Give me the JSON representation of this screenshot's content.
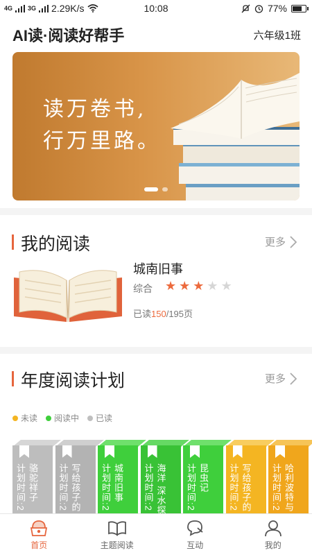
{
  "status_bar": {
    "signal_1": "4G",
    "signal_2": "3G",
    "network_speed": "2.29K/s",
    "time": "10:08",
    "battery": "77%",
    "battery_level": 0.77
  },
  "header": {
    "title": "AI读·阅读好帮手",
    "class_name": "六年级1班"
  },
  "banner": {
    "line1": "读万卷书,",
    "line2": "行万里路。",
    "slide_count": 2,
    "active_slide": 0
  },
  "my_reading": {
    "section_title": "我的阅读",
    "more_label": "更多",
    "book": {
      "title": "城南旧事",
      "category": "综合",
      "rating": 3,
      "rating_max": 5,
      "progress_prefix": "已读",
      "pages_read": "150",
      "pages_total": "/195页"
    }
  },
  "annual_plan": {
    "section_title": "年度阅读计划",
    "more_label": "更多",
    "legend": [
      {
        "label": "未读",
        "color": "#f4b522"
      },
      {
        "label": "阅读中",
        "color": "#3fcf3c"
      },
      {
        "label": "已读",
        "color": "#bfbfbf"
      }
    ],
    "books": [
      {
        "title": "骆驼祥子",
        "plan": "计划时间:2",
        "status": "已读",
        "color": "#bdbdbd",
        "top_color": "#d6d6d6"
      },
      {
        "title": "写给孩子的",
        "plan": "计划时间:2",
        "status": "已读",
        "color": "#b3b3b3",
        "top_color": "#cfcfcf"
      },
      {
        "title": "城南旧事",
        "plan": "计划时间:2",
        "status": "阅读中",
        "color": "#3fcf3c",
        "top_color": "#6fe06c"
      },
      {
        "title": "海洋 深水探",
        "plan": "计划时间:2",
        "status": "阅读中",
        "color": "#39c236",
        "top_color": "#66d964"
      },
      {
        "title": "昆虫记",
        "plan": "计划时间:2",
        "status": "阅读中",
        "color": "#3fcf3c",
        "top_color": "#6fe06c"
      },
      {
        "title": "写给孩子的",
        "plan": "计划时间:2",
        "status": "未读",
        "color": "#f4b522",
        "top_color": "#f8cd5f"
      },
      {
        "title": "哈利波特与",
        "plan": "计划时间:2",
        "status": "未读",
        "color": "#f0a61c",
        "top_color": "#f6c457"
      }
    ]
  },
  "bottom_nav": [
    {
      "label": "首页",
      "icon": "home-icon",
      "active": true
    },
    {
      "label": "主题阅读",
      "icon": "book-icon",
      "active": false
    },
    {
      "label": "互动",
      "icon": "chat-icon",
      "active": false
    },
    {
      "label": "我的",
      "icon": "user-icon",
      "active": false
    }
  ],
  "colors": {
    "accent": "#e6653d",
    "star_on": "#ec6a3d",
    "star_off": "#d6d6d6"
  }
}
